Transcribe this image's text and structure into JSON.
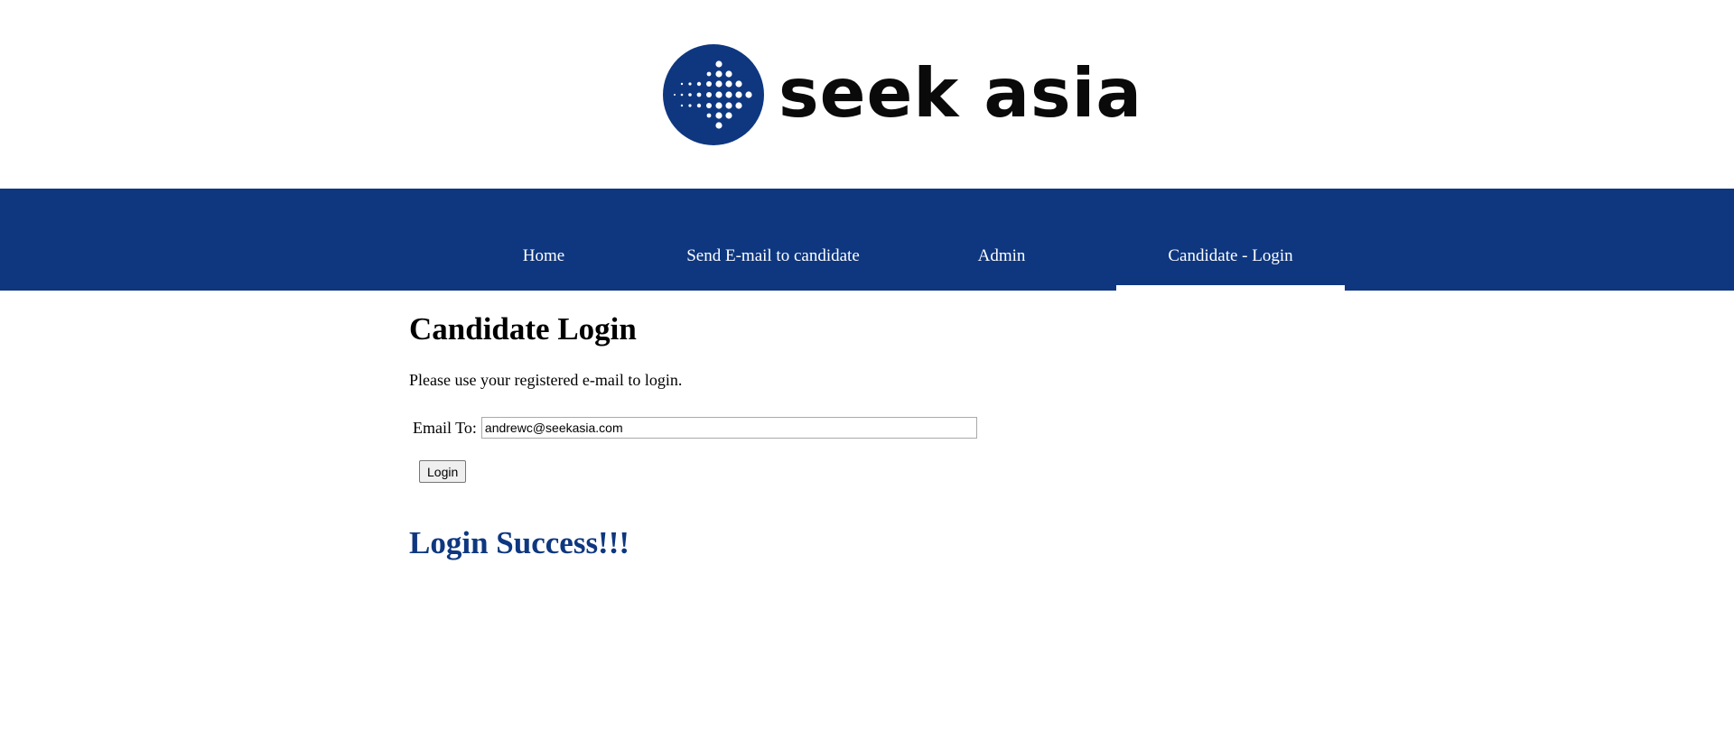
{
  "header": {
    "logo_text": "seek asia",
    "logo_icon": "seek-asia-arrow-logo"
  },
  "nav": {
    "items": [
      {
        "label": "Home"
      },
      {
        "label": "Send E-mail to candidate"
      },
      {
        "label": "Admin"
      },
      {
        "label": "Candidate - Login",
        "active": true
      }
    ]
  },
  "main": {
    "title": "Candidate Login",
    "instructions": "Please use your registered e-mail to login.",
    "email_label": "Email To:",
    "email_value": "andrewc@seekasia.com",
    "login_button": "Login",
    "success_message": "Login Success!!!"
  },
  "colors": {
    "brand_blue": "#0e3780",
    "nav_text": "#ffffff",
    "success_text": "#0e3780"
  }
}
